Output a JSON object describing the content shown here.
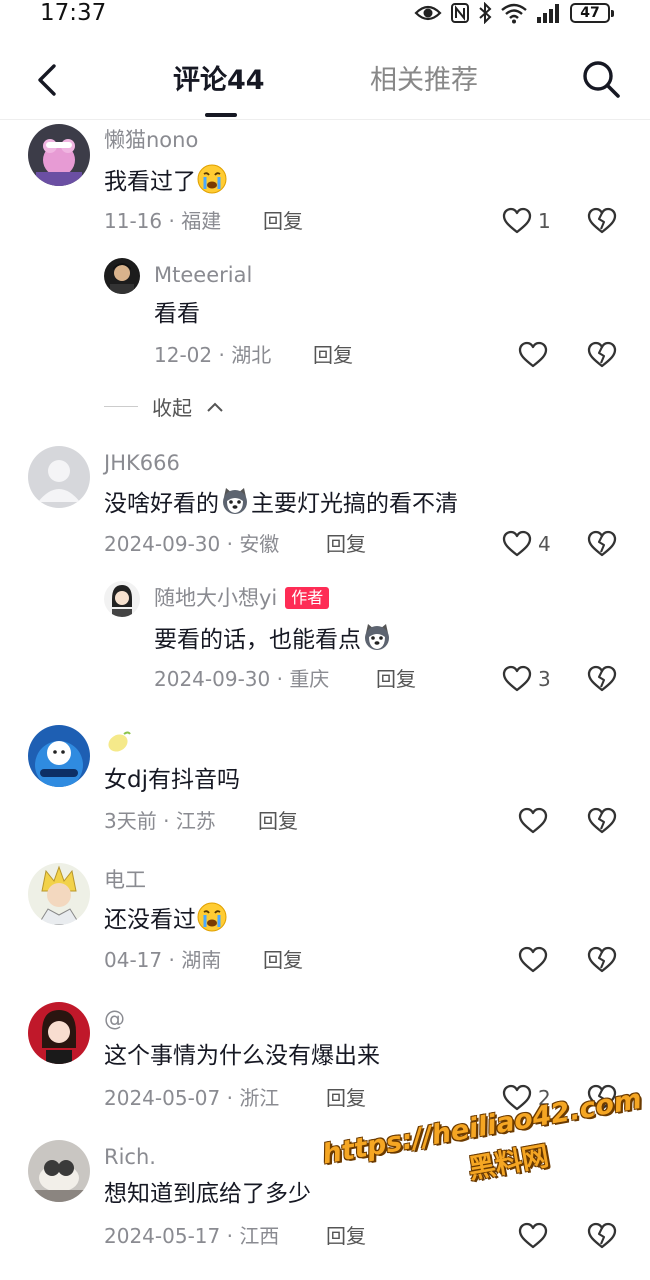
{
  "status_bar": {
    "time": "17:37",
    "battery": "47"
  },
  "header": {
    "tab_comments": "评论44",
    "tab_related": "相关推荐"
  },
  "comments": [
    {
      "username": "懒猫nono",
      "content": "我看过了",
      "date": "11-16",
      "location": "福建",
      "reply": "回复",
      "likes": "1",
      "replies": [
        {
          "username": "Mteeerial",
          "content": "看看",
          "date": "12-02",
          "location": "湖北",
          "reply": "回复",
          "likes": ""
        }
      ],
      "collapse_label": "收起"
    },
    {
      "username": "JHK666",
      "content_a": "没啥好看的",
      "content_b": "主要灯光搞的看不清",
      "date": "2024-09-30",
      "location": "安徽",
      "reply": "回复",
      "likes": "4",
      "replies": [
        {
          "username": "随地大小想yi",
          "badge": "作者",
          "content": "要看的话，也能看点",
          "date": "2024-09-30",
          "location": "重庆",
          "reply": "回复",
          "likes": "3"
        }
      ]
    },
    {
      "username": "",
      "content": "女dj有抖音吗",
      "date": "3天前",
      "location": "江苏",
      "reply": "回复",
      "likes": ""
    },
    {
      "username": "电工",
      "content": "还没看过",
      "date": "04-17",
      "location": "湖南",
      "reply": "回复",
      "likes": ""
    },
    {
      "username": "@",
      "content": "这个事情为什么没有爆出来",
      "date": "2024-05-07",
      "location": "浙江",
      "reply": "回复",
      "likes": "2"
    },
    {
      "username": "Rich.",
      "content": "想知道到底给了多少",
      "date": "2024-05-17",
      "location": "江西",
      "reply": "回复",
      "likes": ""
    }
  ],
  "meta_separator": " · ",
  "watermark": {
    "url": "https://heiliao42.com",
    "name": "黑料网"
  },
  "colors": {
    "accent_badge": "#fe2c55",
    "text_primary": "#161823",
    "text_secondary": "#8a8b91"
  }
}
